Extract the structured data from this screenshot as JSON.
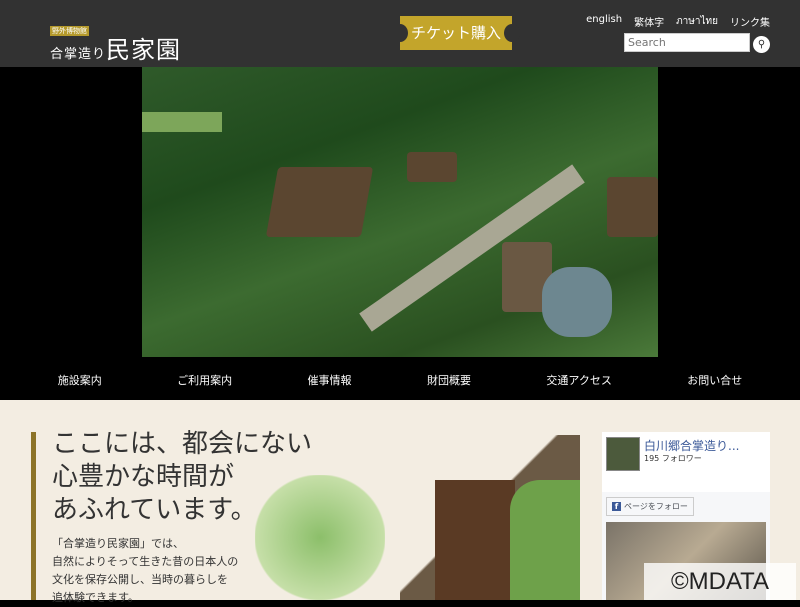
{
  "header": {
    "logo_tag": "野外博物館",
    "logo_small": "合掌造り",
    "logo_main": "民家園",
    "ticket_label": "チケット購入",
    "languages": [
      "english",
      "繁体字",
      "ภาษาไทย",
      "リンク集"
    ],
    "search_placeholder": "Search"
  },
  "nav": [
    "施設案内",
    "ご利用案内",
    "催事情報",
    "財団概要",
    "交通アクセス",
    "お問い合せ"
  ],
  "intro": {
    "headline": [
      "ここには、都会にない",
      "心豊かな時間が",
      "あふれています。"
    ],
    "body": [
      "「合掌造り民家園」では、",
      "自然によりそって生きた昔の日本人の",
      "文化を保存公開し、当時の暮らしを",
      "追体験できます。"
    ]
  },
  "facebook": {
    "page_name": "白川郷合掌造り...",
    "followers": "195 フォロワー",
    "follow_label": "ページをフォロー",
    "icon": "f"
  },
  "watermark": "©MDATA"
}
